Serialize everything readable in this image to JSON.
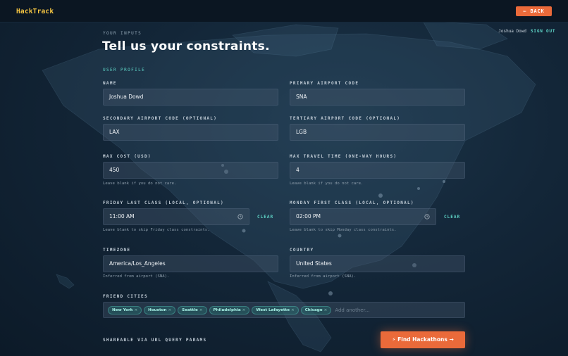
{
  "app": {
    "logo": "HackTrack",
    "back_label": "← BACK"
  },
  "user": {
    "name": "Joshua Dowd",
    "sign_out_label": "SIGN OUT"
  },
  "header": {
    "eyebrow": "YOUR INPUTS",
    "title": "Tell us your constraints."
  },
  "profile": {
    "section_label": "USER PROFILE",
    "name": {
      "label": "NAME",
      "value": "Joshua Dowd"
    },
    "primary_airport": {
      "label": "PRIMARY AIRPORT CODE",
      "value": "SNA"
    },
    "secondary_airport": {
      "label": "SECONDARY AIRPORT CODE (OPTIONAL)",
      "value": "LAX"
    },
    "tertiary_airport": {
      "label": "TERTIARY AIRPORT CODE (OPTIONAL)",
      "value": "LGB"
    },
    "max_cost": {
      "label": "MAX COST (USD)",
      "value": "450",
      "hint": "Leave blank if you do not care."
    },
    "max_travel_time": {
      "label": "MAX TRAVEL TIME (ONE-WAY HOURS)",
      "value": "4",
      "hint": "Leave blank if you do not care."
    },
    "friday_last_class": {
      "label": "FRIDAY LAST CLASS (LOCAL, OPTIONAL)",
      "value": "11:00 AM",
      "clear_label": "CLEAR",
      "hint": "Leave blank to skip Friday class constraints."
    },
    "monday_first_class": {
      "label": "MONDAY FIRST CLASS (LOCAL, OPTIONAL)",
      "value": "02:00 PM",
      "clear_label": "CLEAR",
      "hint": "Leave blank to skip Monday class constraints."
    },
    "timezone": {
      "label": "TIMEZONE",
      "value": "America/Los_Angeles",
      "hint": "Inferred from airport (SNA)."
    },
    "country": {
      "label": "COUNTRY",
      "value": "United States",
      "hint": "Inferred from airport (SNA)."
    },
    "friend_cities": {
      "label": "FRIEND CITIES",
      "chips": [
        "New York",
        "Houston",
        "Seattle",
        "Philadelphia",
        "West Lafayette",
        "Chicago"
      ],
      "remove_glyph": "×",
      "placeholder": "Add another..."
    }
  },
  "footer": {
    "shareable": "SHAREABLE VIA URL QUERY PARAMS",
    "find_button": "⚡ Find Hackathons →"
  },
  "colors": {
    "accent_orange": "#ea6a3a",
    "accent_teal": "#5fd6c8",
    "logo_yellow": "#f5c542"
  }
}
